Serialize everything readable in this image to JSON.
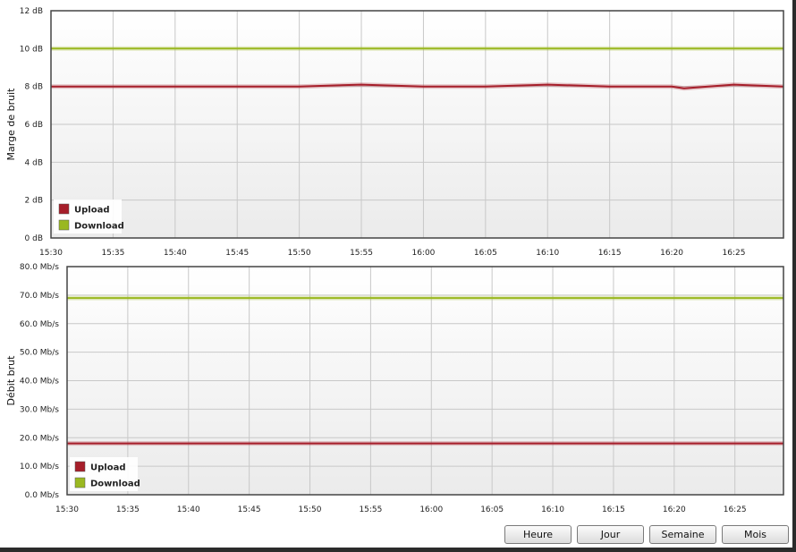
{
  "charts": [
    {
      "type": "line",
      "ylabel": "Marge de bruit",
      "ylim": [
        0,
        12
      ],
      "y_ticks": [
        "0 dB",
        "2 dB",
        "4 dB",
        "6 dB",
        "8 dB",
        "10 dB",
        "12 dB"
      ],
      "x_ticks": [
        "15:30",
        "15:35",
        "15:40",
        "15:45",
        "15:50",
        "15:55",
        "16:00",
        "16:05",
        "16:10",
        "16:15",
        "16:20",
        "16:25"
      ],
      "xlim": [
        "15:30",
        "16:29"
      ],
      "grid": true,
      "legend_position": "bottom-left",
      "series": [
        {
          "name": "Upload",
          "color": "#a61e2a",
          "x": [
            "15:30",
            "15:40",
            "15:50",
            "15:55",
            "16:00",
            "16:05",
            "16:10",
            "16:15",
            "16:20",
            "16:21",
            "16:25",
            "16:29"
          ],
          "y": [
            8.0,
            8.0,
            8.0,
            8.1,
            8.0,
            8.0,
            8.1,
            8.0,
            8.0,
            7.9,
            8.1,
            8.0
          ]
        },
        {
          "name": "Download",
          "color": "#9ab820",
          "x": [
            "15:30",
            "15:40",
            "15:45",
            "15:50",
            "15:55",
            "16:00",
            "16:05",
            "16:10",
            "16:20",
            "16:29"
          ],
          "y": [
            10.0,
            10.0,
            10.0,
            10.0,
            10.0,
            10.0,
            10.0,
            10.0,
            10.0,
            10.0
          ]
        }
      ]
    },
    {
      "type": "line",
      "ylabel": "Débit brut",
      "ylim": [
        0,
        80
      ],
      "y_ticks": [
        "0.0 Mb/s",
        "10.0 Mb/s",
        "20.0 Mb/s",
        "30.0 Mb/s",
        "40.0 Mb/s",
        "50.0 Mb/s",
        "60.0 Mb/s",
        "70.0 Mb/s",
        "80.0 Mb/s"
      ],
      "x_ticks": [
        "15:30",
        "15:35",
        "15:40",
        "15:45",
        "15:50",
        "15:55",
        "16:00",
        "16:05",
        "16:10",
        "16:15",
        "16:20",
        "16:25"
      ],
      "xlim": [
        "15:30",
        "16:29"
      ],
      "grid": true,
      "legend_position": "bottom-left",
      "series": [
        {
          "name": "Upload",
          "color": "#a61e2a",
          "x": [
            "15:30",
            "16:29"
          ],
          "y": [
            18.0,
            18.0
          ]
        },
        {
          "name": "Download",
          "color": "#9ab820",
          "x": [
            "15:30",
            "16:29"
          ],
          "y": [
            69.0,
            69.0
          ]
        }
      ]
    }
  ],
  "buttons": {
    "hour": "Heure",
    "day": "Jour",
    "week": "Semaine",
    "month": "Mois"
  }
}
